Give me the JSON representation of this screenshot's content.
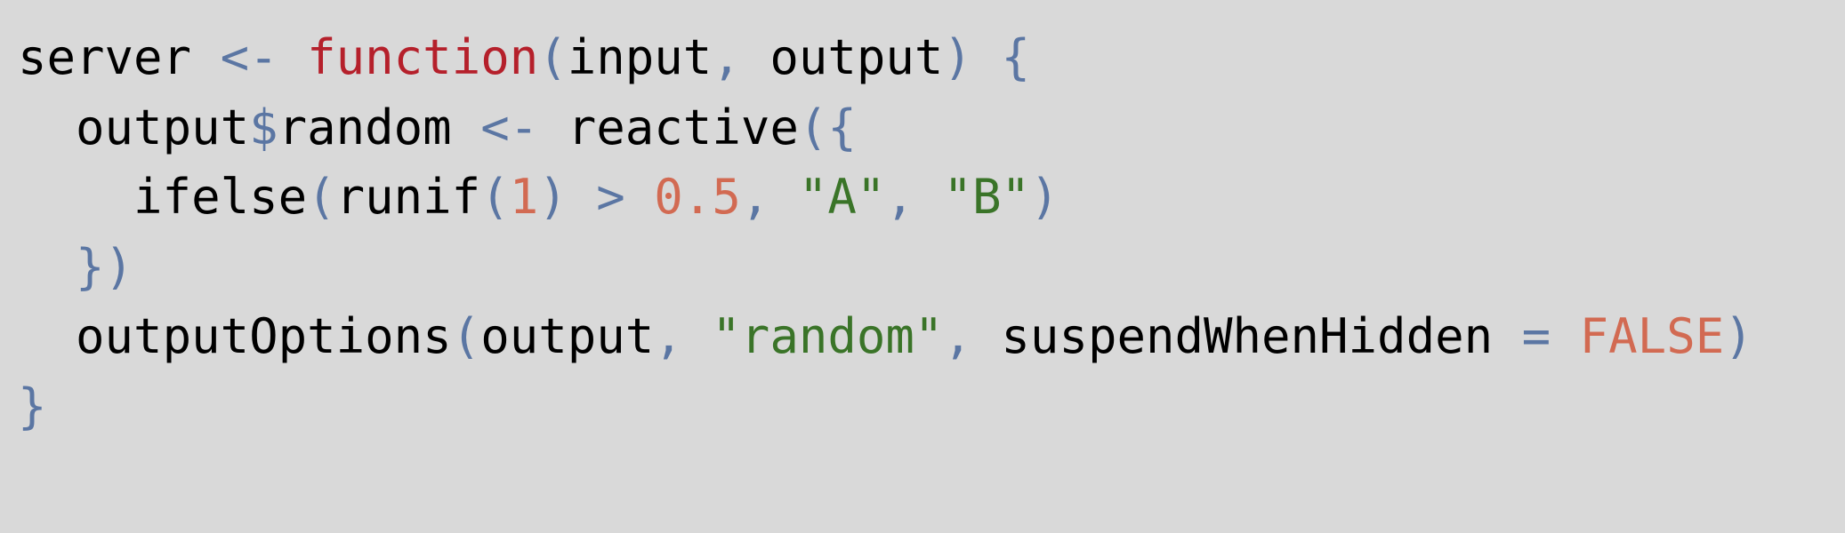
{
  "colors": {
    "default": "#000000",
    "keyword": "#b5202b",
    "operator": "#5b76a3",
    "number": "#d26a52",
    "string": "#3a7428",
    "background": "#d9d9d9"
  },
  "lines": [
    {
      "indent": "",
      "tokens": [
        {
          "text": "server",
          "type": "default"
        },
        {
          "text": " ",
          "type": "default"
        },
        {
          "text": "<-",
          "type": "operator"
        },
        {
          "text": " ",
          "type": "default"
        },
        {
          "text": "function",
          "type": "keyword"
        },
        {
          "text": "(",
          "type": "operator"
        },
        {
          "text": "input",
          "type": "default"
        },
        {
          "text": ",",
          "type": "operator"
        },
        {
          "text": " output",
          "type": "default"
        },
        {
          "text": ")",
          "type": "operator"
        },
        {
          "text": " ",
          "type": "default"
        },
        {
          "text": "{",
          "type": "operator"
        }
      ]
    },
    {
      "indent": "  ",
      "tokens": [
        {
          "text": "output",
          "type": "default"
        },
        {
          "text": "$",
          "type": "operator"
        },
        {
          "text": "random",
          "type": "default"
        },
        {
          "text": " ",
          "type": "default"
        },
        {
          "text": "<-",
          "type": "operator"
        },
        {
          "text": " reactive",
          "type": "default"
        },
        {
          "text": "({",
          "type": "operator"
        }
      ]
    },
    {
      "indent": "    ",
      "tokens": [
        {
          "text": "ifelse",
          "type": "default"
        },
        {
          "text": "(",
          "type": "operator"
        },
        {
          "text": "runif",
          "type": "default"
        },
        {
          "text": "(",
          "type": "operator"
        },
        {
          "text": "1",
          "type": "number"
        },
        {
          "text": ")",
          "type": "operator"
        },
        {
          "text": " ",
          "type": "default"
        },
        {
          "text": ">",
          "type": "operator"
        },
        {
          "text": " ",
          "type": "default"
        },
        {
          "text": "0.5",
          "type": "number"
        },
        {
          "text": ",",
          "type": "operator"
        },
        {
          "text": " ",
          "type": "default"
        },
        {
          "text": "\"A\"",
          "type": "string"
        },
        {
          "text": ",",
          "type": "operator"
        },
        {
          "text": " ",
          "type": "default"
        },
        {
          "text": "\"B\"",
          "type": "string"
        },
        {
          "text": ")",
          "type": "operator"
        }
      ]
    },
    {
      "indent": "  ",
      "tokens": [
        {
          "text": "})",
          "type": "operator"
        }
      ]
    },
    {
      "indent": "  ",
      "tokens": [
        {
          "text": "outputOptions",
          "type": "default"
        },
        {
          "text": "(",
          "type": "operator"
        },
        {
          "text": "output",
          "type": "default"
        },
        {
          "text": ",",
          "type": "operator"
        },
        {
          "text": " ",
          "type": "default"
        },
        {
          "text": "\"random\"",
          "type": "string"
        },
        {
          "text": ",",
          "type": "operator"
        },
        {
          "text": " suspendWhenHidden ",
          "type": "default"
        },
        {
          "text": "=",
          "type": "operator"
        },
        {
          "text": " ",
          "type": "default"
        },
        {
          "text": "FALSE",
          "type": "number"
        },
        {
          "text": ")",
          "type": "operator"
        }
      ]
    },
    {
      "indent": "",
      "tokens": [
        {
          "text": "}",
          "type": "operator"
        }
      ]
    }
  ]
}
